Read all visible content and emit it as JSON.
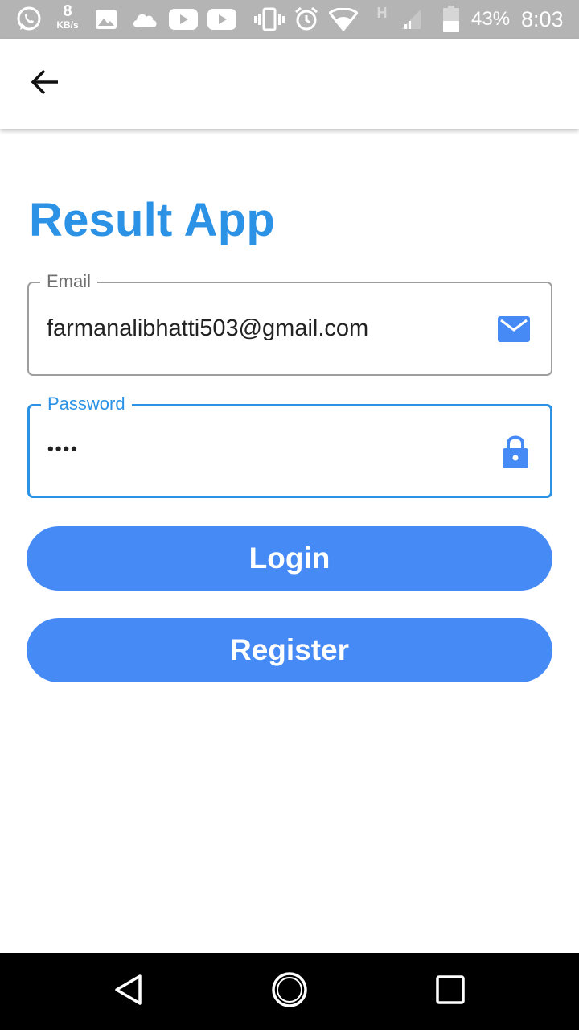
{
  "status_bar": {
    "net_speed_value": "8",
    "net_speed_unit": "KB/s",
    "battery_percent": "43%",
    "time": "8:03",
    "network_type": "H",
    "icons": [
      "whatsapp-icon",
      "net-speed",
      "image-icon",
      "cloud-icon",
      "youtube-icon",
      "youtube-icon",
      "vibrate-icon",
      "alarm-icon",
      "wifi-icon",
      "signal-icon",
      "battery-icon"
    ]
  },
  "app_bar": {
    "back_icon": "arrow-left-icon"
  },
  "main": {
    "title": "Result App",
    "email": {
      "label": "Email",
      "value": "farmanalibhatti503@gmail.com",
      "icon": "mail-icon"
    },
    "password": {
      "label": "Password",
      "value": "••••",
      "icon": "lock-icon"
    },
    "login_label": "Login",
    "register_label": "Register"
  },
  "nav_bar": {
    "icons": [
      "back-triangle-icon",
      "home-circle-icon",
      "recents-square-icon"
    ]
  },
  "colors": {
    "accent": "#2b92e5",
    "button": "#458af5",
    "status_bar": "#b4b4b4",
    "nav_bar": "#000000"
  }
}
